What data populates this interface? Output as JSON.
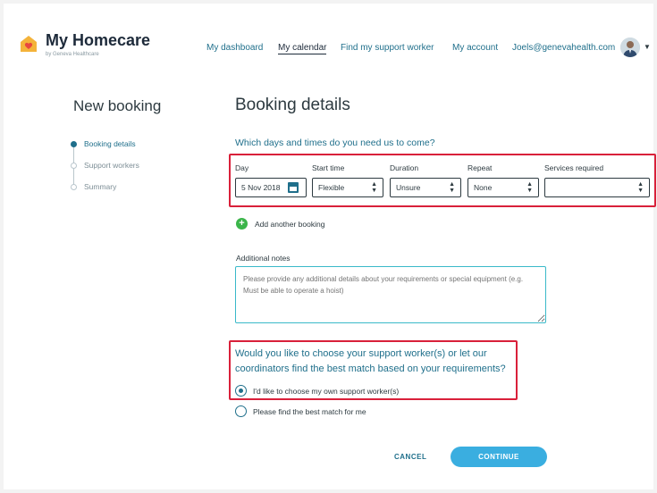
{
  "brand": {
    "title": "My Homecare",
    "subtitle": "by Geneva Healthcare",
    "accent": "#1f6f8b",
    "heart_color": "#e8473f",
    "house_color": "#f4b33a"
  },
  "nav": {
    "items": [
      "My dashboard",
      "My calendar",
      "Find my support worker",
      "My account"
    ],
    "active": "My calendar",
    "user_email": "Joels@genevahealth.com",
    "avatar_icon": "user-avatar",
    "menu_icon": "chevron-down-icon"
  },
  "sidebar": {
    "title": "New booking",
    "steps": [
      {
        "label": "Booking details",
        "active": true
      },
      {
        "label": "Support workers",
        "active": false
      },
      {
        "label": "Summary",
        "active": false
      }
    ]
  },
  "main": {
    "title": "Booking details",
    "question": "Which days and times do you need us to come?",
    "fields": {
      "day": {
        "label": "Day",
        "value": "5 Nov 2018",
        "icon": "calendar-icon"
      },
      "start_time": {
        "label": "Start time",
        "value": "Flexible"
      },
      "duration": {
        "label": "Duration",
        "value": "Unsure"
      },
      "repeat": {
        "label": "Repeat",
        "value": "None"
      },
      "services": {
        "label": "Services required",
        "value": ""
      }
    },
    "add_booking": "Add another booking",
    "notes": {
      "label": "Additional notes",
      "placeholder": "Please provide any additional details about your requirements or special equipment (e.g. Must be able to operate a hoist)"
    },
    "choose_question": "Would you like to choose your support worker(s) or let our coordinators find the best match based on your requirements?",
    "options": [
      {
        "label": "I'd like to choose my own support worker(s)",
        "checked": true
      },
      {
        "label": "Please find the best match for me",
        "checked": false
      }
    ],
    "cancel_label": "CANCEL",
    "continue_label": "CONTINUE",
    "highlight_color": "#d9203a",
    "button_color": "#3aaee0"
  }
}
